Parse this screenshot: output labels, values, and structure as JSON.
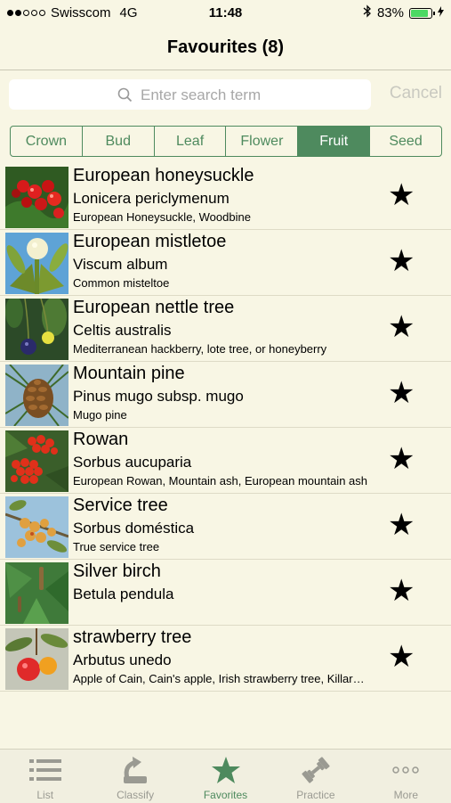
{
  "status": {
    "carrier": "Swisscom",
    "network": "4G",
    "time": "11:48",
    "battery": "83%",
    "signal_bars": 2,
    "signal_total": 5
  },
  "nav": {
    "title": "Favourites (8)"
  },
  "search": {
    "placeholder": "Enter search term",
    "value": "",
    "cancel_label": "Cancel"
  },
  "segments": [
    "Crown",
    "Bud",
    "Leaf",
    "Flower",
    "Fruit",
    "Seed"
  ],
  "segments_selected": "Fruit",
  "items": [
    {
      "name": "European honeysuckle",
      "latin": "Lonicera periclymenum",
      "common": "European Honeysuckle, Woodbine",
      "starred": true
    },
    {
      "name": "European mistletoe",
      "latin": "Viscum album",
      "common": "Common misteltoe",
      "starred": true
    },
    {
      "name": "European nettle tree",
      "latin": "Celtis australis",
      "common": "Mediterranean hackberry, lote tree, or honeyberry",
      "starred": true
    },
    {
      "name": "Mountain pine",
      "latin": "Pinus mugo subsp. mugo",
      "common": "Mugo pine",
      "starred": true
    },
    {
      "name": "Rowan",
      "latin": "Sorbus aucuparia",
      "common": "European Rowan, Mountain ash, European mountain ash",
      "starred": true
    },
    {
      "name": "Service tree",
      "latin": "Sorbus doméstica",
      "common": "True service tree",
      "starred": true
    },
    {
      "name": "Silver birch",
      "latin": "Betula pendula",
      "common": "",
      "starred": true
    },
    {
      "name": "strawberry tree",
      "latin": "Arbutus unedo",
      "common": "Apple of Cain, Cain's apple, Irish strawberry tree, Killar…",
      "starred": true
    }
  ],
  "star_glyph": "★",
  "tabs": [
    {
      "label": "List",
      "icon": "list-icon"
    },
    {
      "label": "Classify",
      "icon": "classify-icon"
    },
    {
      "label": "Favorites",
      "icon": "star-icon"
    },
    {
      "label": "Practice",
      "icon": "dumbbell-icon"
    },
    {
      "label": "More",
      "icon": "more-icon"
    }
  ],
  "active_tab": "Favorites",
  "colors": {
    "accent": "#4e8a5e",
    "background": "#f8f6e4",
    "inactive": "#9a9a92"
  }
}
